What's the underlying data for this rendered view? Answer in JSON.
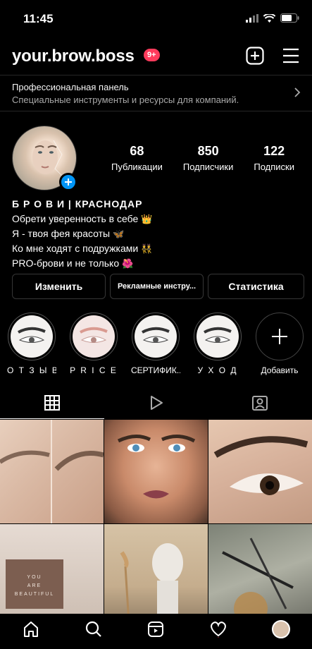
{
  "status_bar": {
    "time": "11:45"
  },
  "header": {
    "username": "your.brow.boss",
    "notification_badge": "9+"
  },
  "pro_panel": {
    "title": "Профессиональная панель",
    "subtitle": "Специальные инструменты и ресурсы для компаний."
  },
  "stats": [
    {
      "value": "68",
      "label": "Публикации"
    },
    {
      "value": "850",
      "label": "Подписчики"
    },
    {
      "value": "122",
      "label": "Подписки"
    }
  ],
  "bio": {
    "name": "Б Р О В И | КРАСНОДАР",
    "lines": [
      "Обрети уверенность в себе",
      "Я - твоя фея красоты",
      "Ко мне ходят с подружками",
      "PRO-брови и не только"
    ]
  },
  "buttons": {
    "edit": "Изменить",
    "ad_tools": "Рекламные инстру...",
    "insights": "Статистика"
  },
  "highlights": [
    {
      "label": "О Т З Ы В Ы"
    },
    {
      "label": "P R I C E"
    },
    {
      "label": "СЕРТИФИК..."
    },
    {
      "label": "У Х О Д"
    }
  ],
  "add_highlight_label": "Добавить",
  "grid_tile_text": [
    "YOU",
    "ARE",
    "BEAUTIFUL"
  ],
  "colors": {
    "accent": "#0095f6",
    "badge": "#ff3b5c",
    "background": "#000000"
  }
}
